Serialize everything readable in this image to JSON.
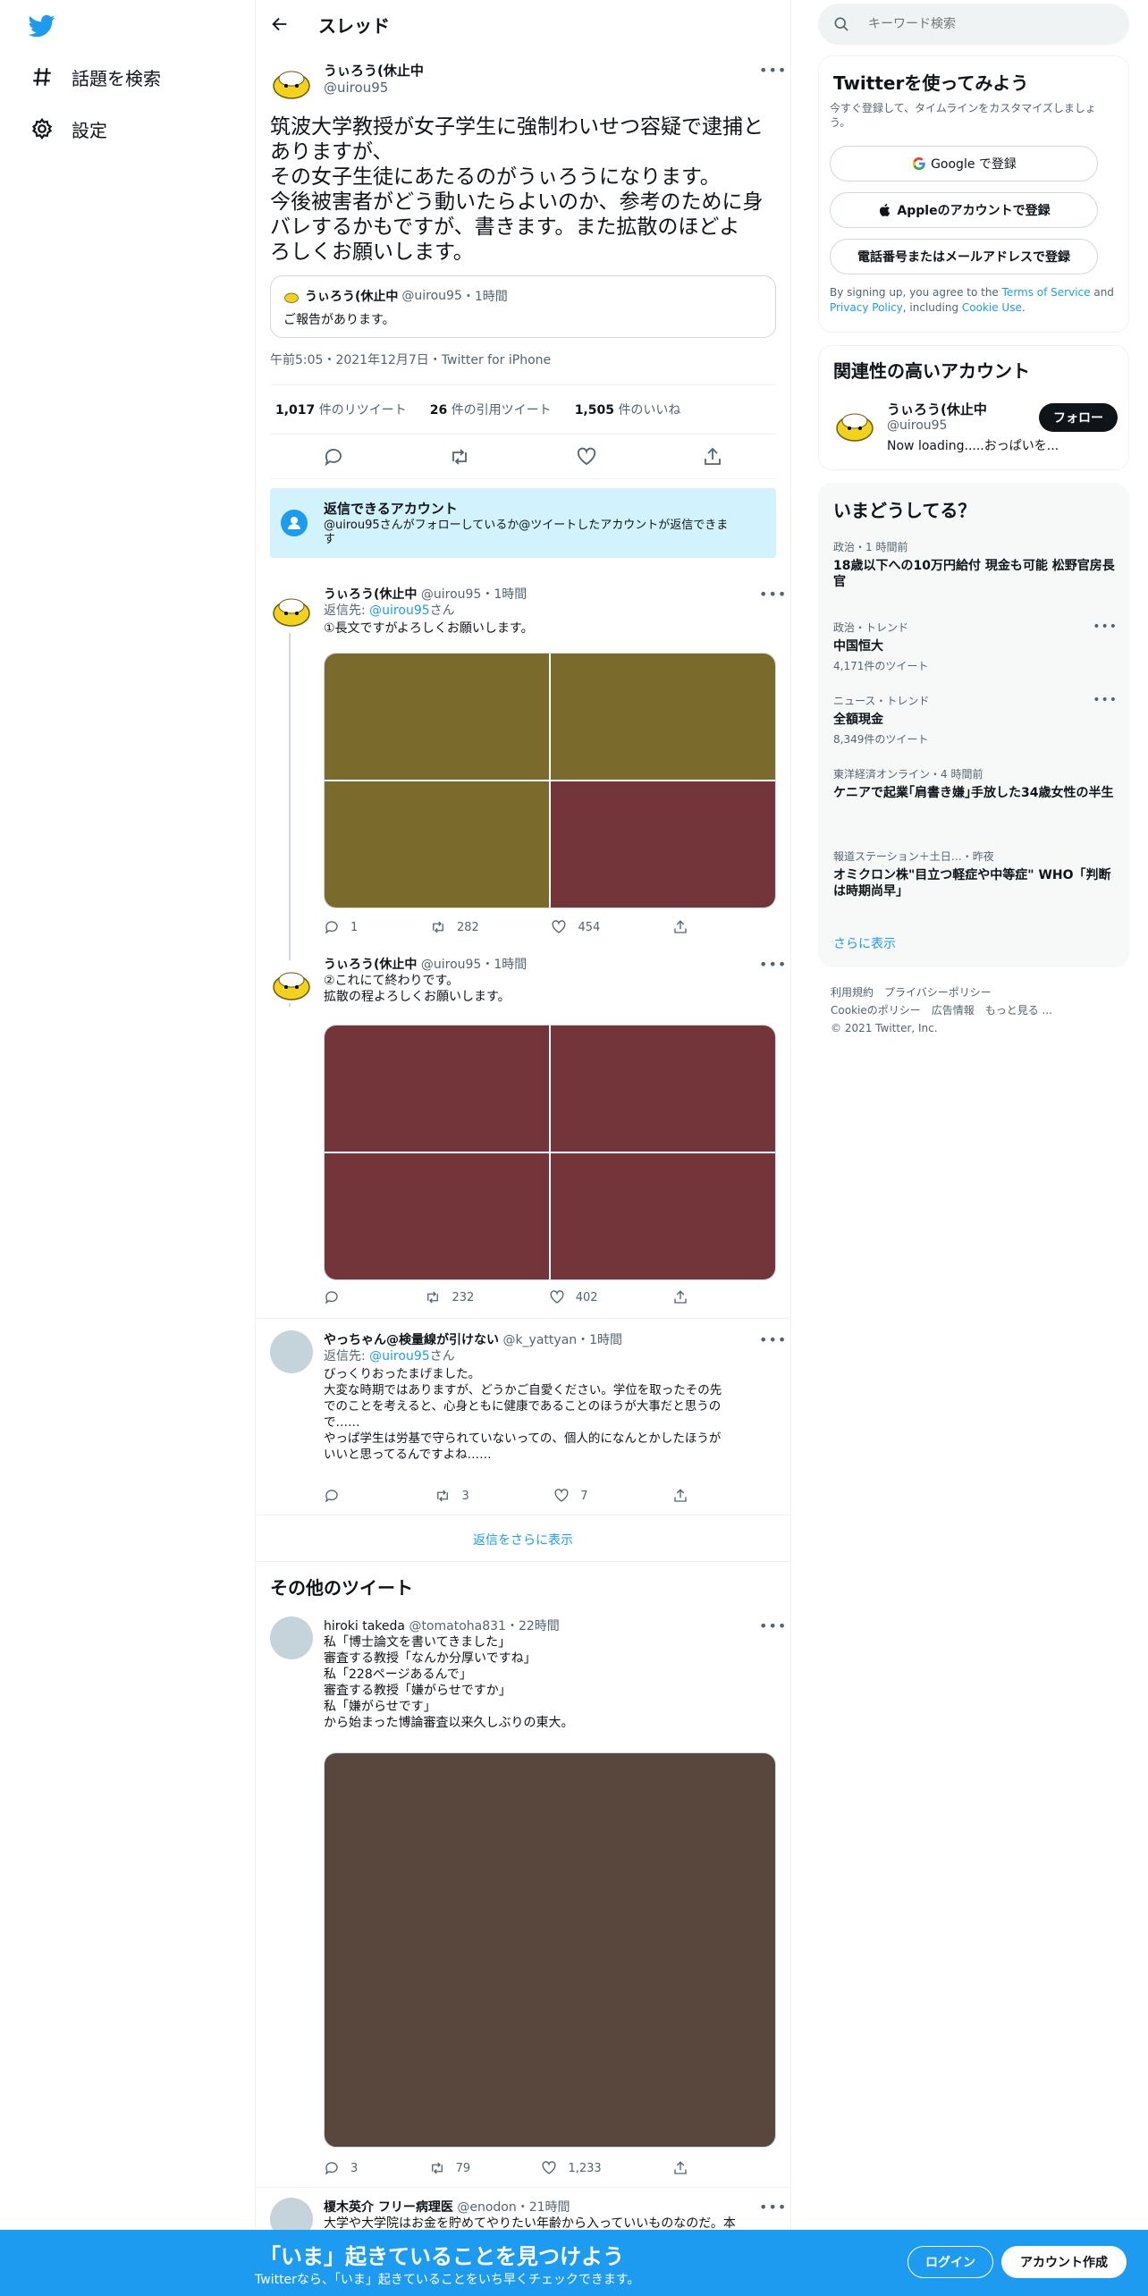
{
  "colors": {
    "accent": "#1d9bf0",
    "text": "#0f1419",
    "muted": "#536471",
    "notice_bg": "#d2f2fd",
    "olive": "#7a6a2c",
    "maroon": "#74353a",
    "brown": "#59463d"
  },
  "nav": {
    "explore": "話題を検索",
    "settings": "設定"
  },
  "header": {
    "title": "スレッド"
  },
  "main_tweet": {
    "name": "うぃろう(休止中",
    "handle": "@uirou95",
    "text": "筑波大学教授が女子学生に強制わいせつ容疑で逮捕と\nありますが、\nその女子生徒にあたるのがうぃろうになります。\n今後被害者がどう動いたらよいのか、参考のために身\nバレするかもですが、書きます。また拡散のほどよ\nろしくお願いします。",
    "quote": {
      "name": "うぃろう(休止中",
      "handle": "@uirou95",
      "time": "1時間",
      "text": "ご報告があります。"
    },
    "meta": "午前5:05・2021年12月7日・Twitter for iPhone",
    "stats": {
      "retweets": "1,017",
      "retweets_label": "件のリツイート",
      "quotes": "26",
      "quotes_label": "件の引用ツイート",
      "likes": "1,505",
      "likes_label": "件のいいね"
    }
  },
  "reply_notice": {
    "title": "返信できるアカウント",
    "text": "@uirou95さんがフォローしているか@ツイートしたアカウントが返信できま\nす"
  },
  "replies": [
    {
      "name": "うぃろう(休止中",
      "handle": "@uirou95",
      "time": "1時間",
      "reply_prefix": "返信先: ",
      "reply_to": "@uirou95",
      "reply_suffix": "さん",
      "text": "①長文ですがよろしくお願いします。",
      "counts": {
        "reply": "1",
        "retweet": "282",
        "like": "454"
      }
    },
    {
      "name": "うぃろう(休止中",
      "handle": "@uirou95",
      "time": "1時間",
      "text": "②これにて終わりです。\n拡散の程よろしくお願いします。",
      "counts": {
        "reply": "",
        "retweet": "232",
        "like": "402"
      }
    },
    {
      "name": "やっちゃん@検量線が引けない",
      "handle": "@k_yattyan",
      "time": "1時間",
      "reply_prefix": "返信先: ",
      "reply_to": "@uirou95",
      "reply_suffix": "さん",
      "text": "びっくりおったまげました。\n大変な時期ではありますが、どうかご自愛ください。学位を取ったその先\nでのことを考えると、心身ともに健康であることのほうが大事だと思うの\nで……\nやっぱ学生は労基で守られていないっての、個人的になんとかしたほうが\nいいと思ってるんですよね……",
      "counts": {
        "reply": "",
        "retweet": "3",
        "like": "7"
      }
    }
  ],
  "show_more_replies": "返信をさらに表示",
  "other_tweets_title": "その他のツイート",
  "other_tweets": [
    {
      "name": "hiroki takeda",
      "handle": "@tomatoha831",
      "time": "22時間",
      "text": "私「博士論文を書いてきました」\n審査する教授「なんか分厚いですね」\n私「228ページあるんで」\n審査する教授「嫌がらせですか」\n私「嫌がらせです」\nから始まった博論審査以来久しぶりの東大。",
      "counts": {
        "reply": "3",
        "retweet": "79",
        "like": "1,233"
      }
    },
    {
      "name": "榎木英介 フリー病理医",
      "handle": "@enodon",
      "time": "21時間",
      "text": "大学や大学院はお金を貯めてやりたい年齢から入っていいものなのだ。本"
    }
  ],
  "right": {
    "search_placeholder": "キーワード検索",
    "signup": {
      "title": "Twitterを使ってみよう",
      "subtitle": "今すぐ登録して、タイムラインをカスタマイズしましょう。",
      "google": "Google で登録",
      "apple": "Appleのアカウントで登録",
      "phone": "電話番号またはメールアドレスで登録",
      "legal_1": "By signing up, you agree to the ",
      "tos": "Terms of Service",
      "legal_2": " and ",
      "privacy": "Privacy Policy",
      "legal_3": ", including ",
      "cookie": "Cookie Use",
      "legal_4": "."
    },
    "relevant": {
      "title": "関連性の高いアカウント",
      "name": "うぃろう(休止中",
      "handle": "@uirou95",
      "bio": "Now loading.....おっぱいを...",
      "follow": "フォロー"
    },
    "trends": {
      "title": "いまどうしてる？",
      "items": [
        {
          "cat": "政治・1 時間前",
          "topic": "18歳以下への10万円給付 現金も可能 松野官房長官"
        },
        {
          "cat": "政治・トレンド",
          "topic": "中国恒大",
          "count": "4,171件のツイート"
        },
        {
          "cat": "ニュース・トレンド",
          "topic": "全額現金",
          "count": "8,349件のツイート"
        },
        {
          "cat": "東洋経済オンライン・4 時間前",
          "topic": "ケニアで起業｢肩書き嫌｣手放した34歳女性の半生"
        },
        {
          "cat": "報道ステーション＋土日…・昨夜",
          "topic": "オミクロン株\"目立つ軽症や中等症\" WHO「判断は時期尚早」"
        }
      ],
      "show_more": "さらに表示"
    },
    "footer": {
      "line1": "利用規約　プライバシーポリシー",
      "line2": "Cookieのポリシー　広告情報　もっと見る ...",
      "line3": "© 2021 Twitter, Inc."
    }
  },
  "bottombar": {
    "headline": "「いま」起きていることを見つけよう",
    "sub": "Twitterなら、「いま」起きていることをいち早くチェックできます。",
    "login": "ログイン",
    "signup": "アカウント作成"
  }
}
